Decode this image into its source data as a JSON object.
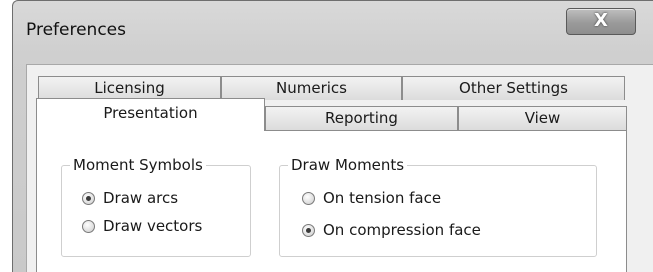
{
  "window": {
    "title": "Preferences",
    "close_glyph": "X"
  },
  "tabs": {
    "row_back": [
      {
        "label": "Licensing"
      },
      {
        "label": "Numerics"
      },
      {
        "label": "Other Settings"
      }
    ],
    "row_front": [
      {
        "label": "Presentation",
        "active": true
      },
      {
        "label": "Reporting",
        "active": false
      },
      {
        "label": "View",
        "active": false
      }
    ]
  },
  "moment_symbols": {
    "title": "Moment Symbols",
    "options": [
      {
        "label": "Draw arcs",
        "checked": true
      },
      {
        "label": "Draw vectors",
        "checked": false
      }
    ]
  },
  "draw_moments": {
    "title": "Draw Moments",
    "options": [
      {
        "label": "On tension face",
        "checked": false
      },
      {
        "label": "On compression face",
        "checked": true
      }
    ]
  }
}
